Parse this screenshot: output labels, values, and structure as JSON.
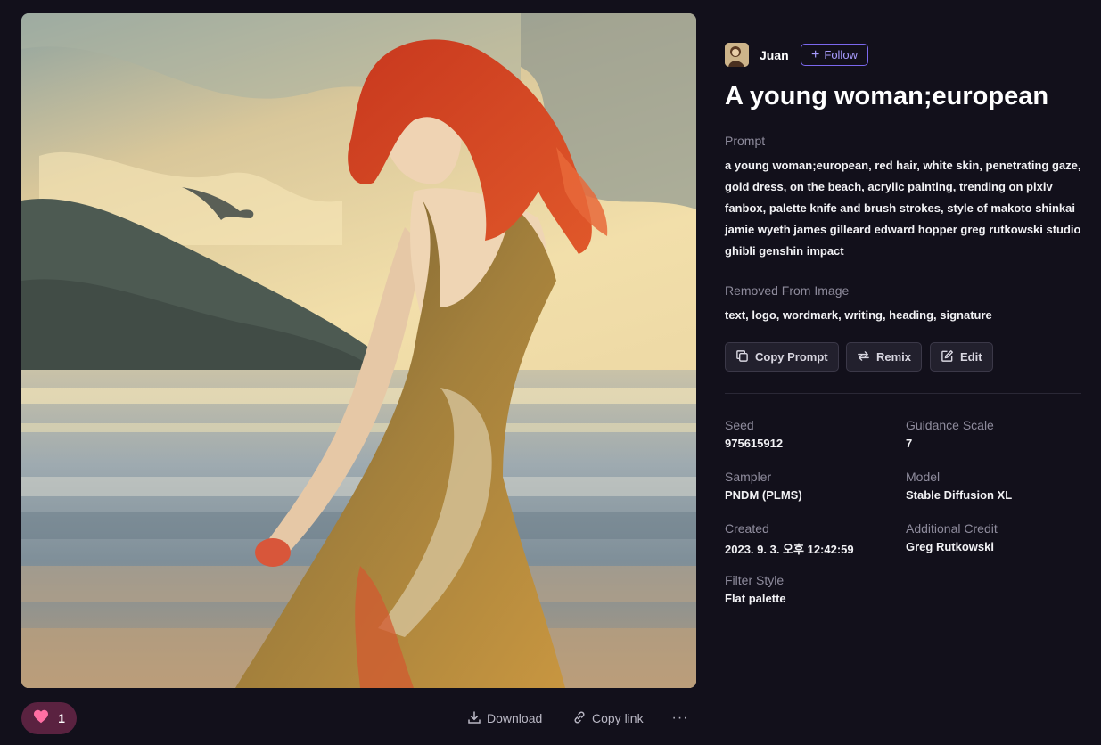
{
  "artwork": {
    "alt": "a young woman;european"
  },
  "author": {
    "name": "Juan",
    "follow_label": "Follow"
  },
  "title": "A young woman;european",
  "prompt": {
    "label": "Prompt",
    "text": "a young woman;european, red hair, white skin, penetrating gaze, gold dress, on the beach, acrylic painting, trending on pixiv fanbox, palette knife and brush strokes, style of makoto shinkai jamie wyeth james gilleard edward hopper greg rutkowski studio ghibli genshin impact"
  },
  "removed": {
    "label": "Removed From Image",
    "text": "text, logo, wordmark, writing, heading, signature"
  },
  "actions": {
    "copy_prompt": "Copy Prompt",
    "remix": "Remix",
    "edit": "Edit"
  },
  "details": {
    "seed_label": "Seed",
    "seed": "975615912",
    "guidance_label": "Guidance Scale",
    "guidance": "7",
    "sampler_label": "Sampler",
    "sampler": "PNDM (PLMS)",
    "model_label": "Model",
    "model": "Stable Diffusion XL",
    "created_label": "Created",
    "created": "2023. 9. 3. 오후 12:42:59",
    "credit_label": "Additional Credit",
    "credit": "Greg Rutkowski",
    "filter_label": "Filter Style",
    "filter": "Flat palette"
  },
  "bottom": {
    "like_count": "1",
    "download": "Download",
    "copy_link": "Copy link",
    "more": "···"
  },
  "colors": {
    "background": "#12101b",
    "accent": "#7b68ee",
    "like_bg": "#5a2240",
    "heart": "#ff6fa3"
  },
  "icons": {
    "like": "heart-icon",
    "download": "download-icon",
    "copy_link": "link-icon",
    "more": "more-icon",
    "follow": "plus-icon",
    "copy_prompt": "copy-icon",
    "remix": "remix-icon",
    "edit": "edit-icon"
  }
}
